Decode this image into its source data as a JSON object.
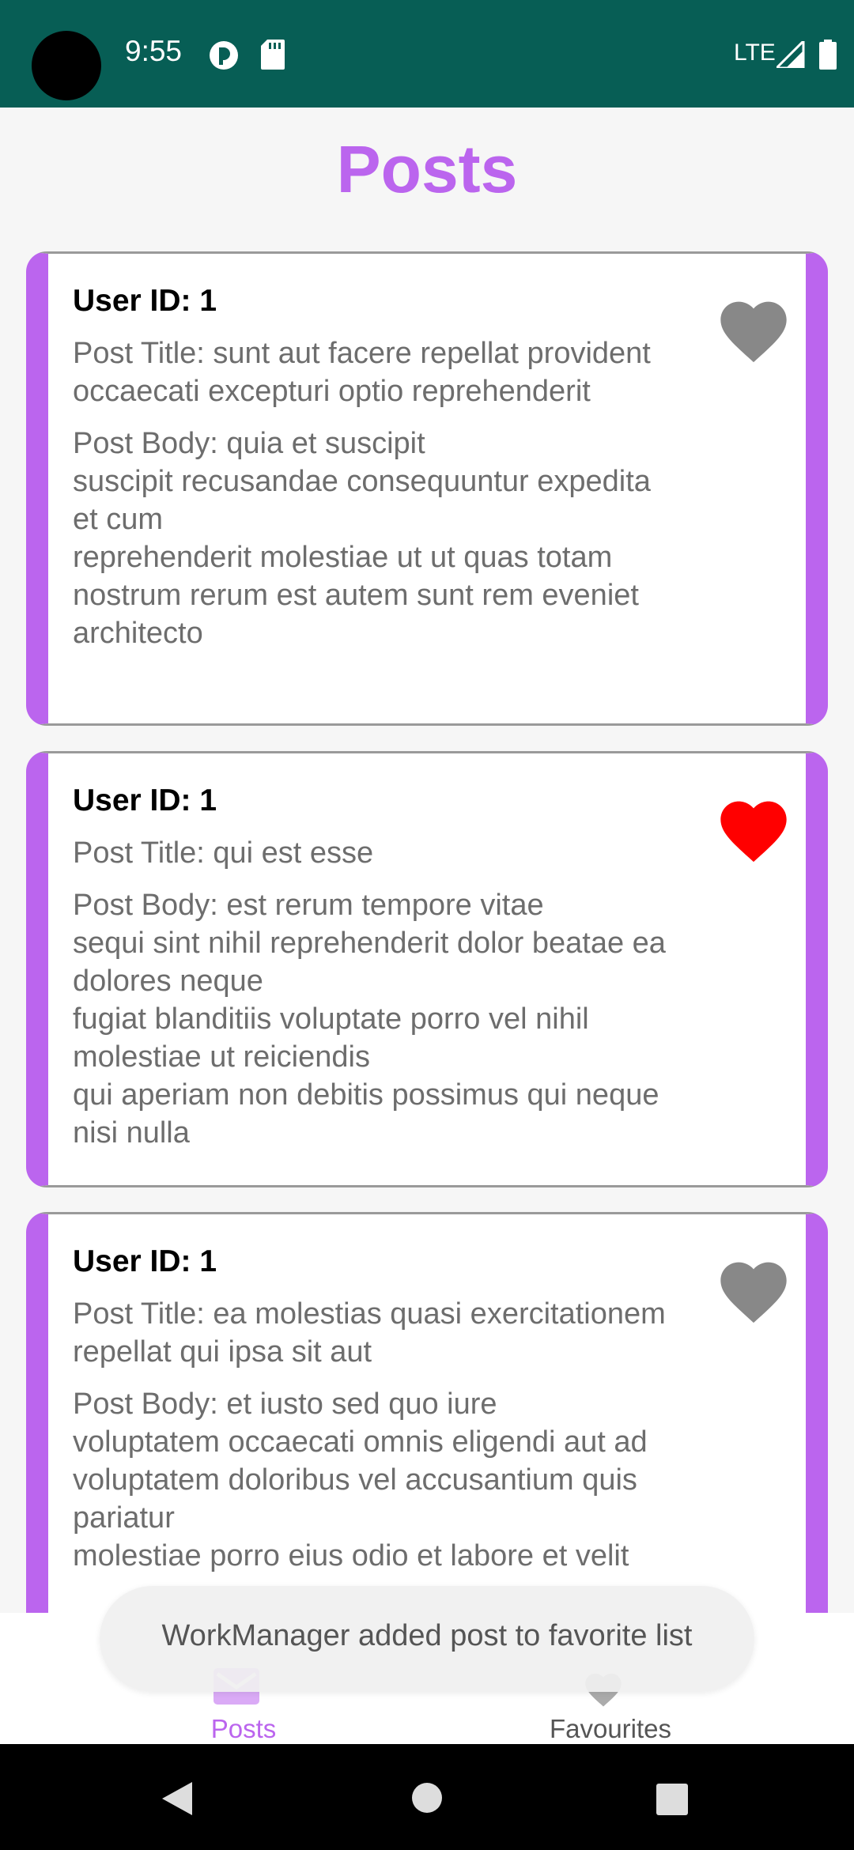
{
  "status_bar": {
    "time": "9:55",
    "network": "LTE",
    "icons": [
      "camera-cutout",
      "data-saver-icon",
      "sd-card-icon",
      "signal-icon",
      "battery-icon"
    ]
  },
  "page": {
    "title": "Posts"
  },
  "posts": [
    {
      "user": "User ID: 1",
      "title": "Post Title: sunt aut facere repellat provident occaecati excepturi optio reprehenderit",
      "body": "Post Body: quia et suscipit\nsuscipit recusandae consequuntur expedita et cum\nreprehenderit molestiae ut ut quas totam\nnostrum rerum est autem sunt rem eveniet architecto",
      "favorite": false
    },
    {
      "user": "User ID: 1",
      "title": "Post Title: qui est esse",
      "body": "Post Body: est rerum tempore vitae\nsequi sint nihil reprehenderit dolor beatae ea dolores neque\nfugiat blanditiis voluptate porro vel nihil molestiae ut reiciendis\nqui aperiam non debitis possimus qui neque nisi nulla",
      "favorite": true
    },
    {
      "user": "User ID: 1",
      "title": "Post Title: ea molestias quasi exercitationem repellat qui ipsa sit aut",
      "body": "Post Body: et iusto sed quo iure\nvoluptatem occaecati omnis eligendi aut ad\nvoluptatem doloribus vel accusantium quis pariatur\nmolestiae porro eius odio et labore et velit",
      "favorite": false
    }
  ],
  "bottom_nav": {
    "items": [
      {
        "label": "Posts",
        "icon": "mail-icon",
        "selected": true
      },
      {
        "label": "Favourites",
        "icon": "heart-icon",
        "selected": false
      }
    ]
  },
  "snackbar": {
    "text": "WorkManager added post to favorite list"
  },
  "colors": {
    "status_bar": "#075e55",
    "accent": "#bb65ee",
    "favorite_active": "#ff0000",
    "favorite_inactive": "#888888"
  }
}
